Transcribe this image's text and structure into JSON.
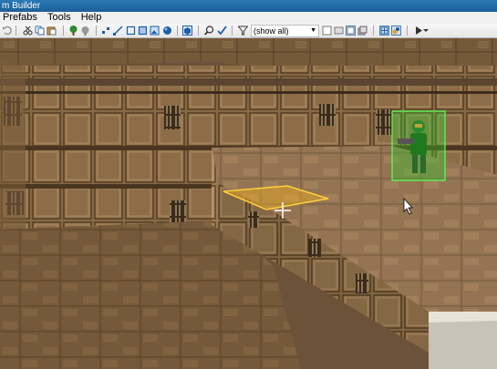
{
  "window": {
    "title": "m Builder"
  },
  "menu": {
    "items": [
      "Prefabs",
      "Tools",
      "Help"
    ]
  },
  "toolbar": {
    "filter_value": "(show all)",
    "icons": [
      "undo-icon",
      "cut-icon",
      "copy-icon",
      "paste-icon",
      "tree-icon",
      "brush-icon",
      "vertex-icon",
      "line-icon",
      "square-icon",
      "square-fill-icon",
      "image-icon",
      "sphere-icon",
      "cube-3d-icon",
      "zoom-icon",
      "check-icon",
      "filter-icon",
      "grid-icon",
      "view-2d-icon",
      "view-3d-icon",
      "layers-icon",
      "grid-toggle-icon",
      "snap-icon",
      "play-icon"
    ],
    "colors": {
      "accent": "#1e6fb8",
      "selection": "#f0b020",
      "thing": "#2fd02f"
    }
  },
  "viewport": {
    "selected_sector_color": "#f0b020",
    "selected_thing": "marine-player-start",
    "thing_highlight_color": "#2fd02f"
  }
}
